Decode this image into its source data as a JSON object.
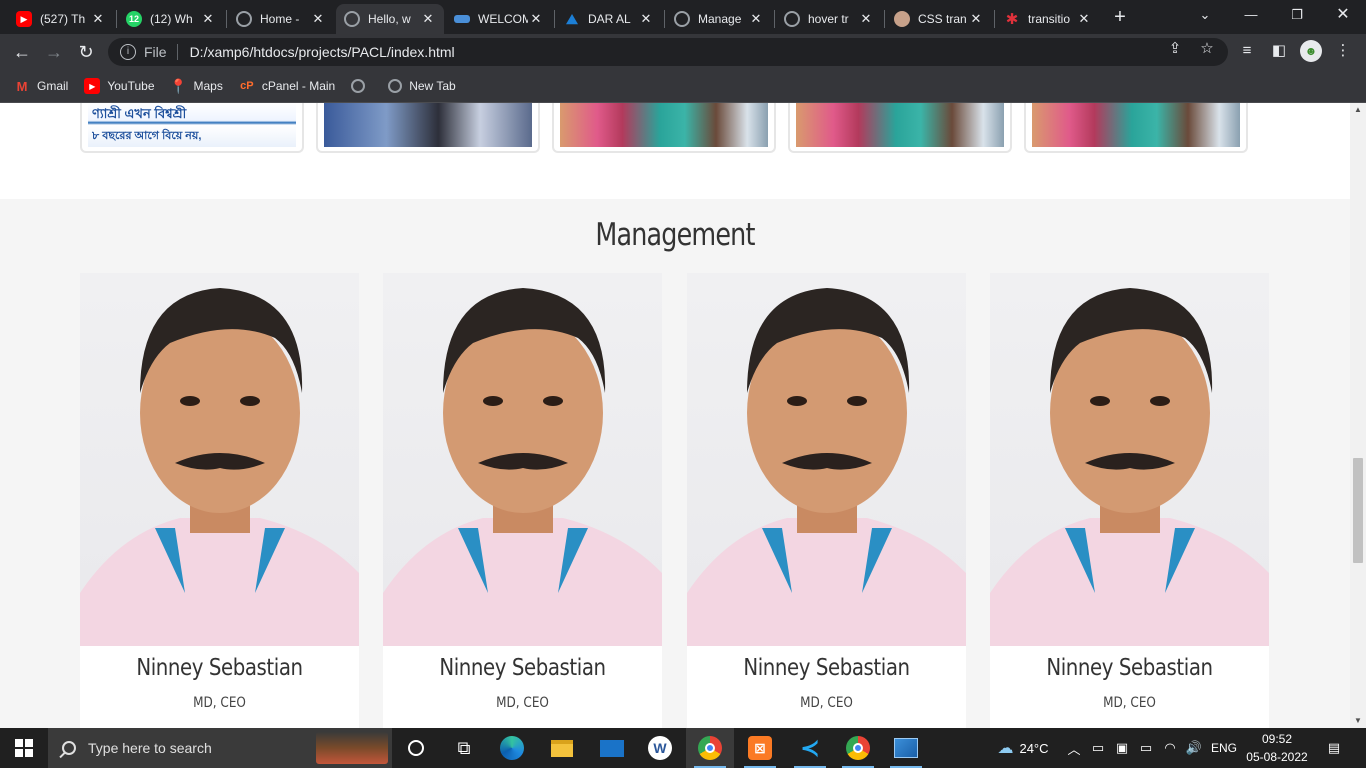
{
  "browser": {
    "tabs": [
      {
        "title": "(527) Th",
        "icon": "youtube-icon",
        "color": "#ff0000",
        "glyph": "▶"
      },
      {
        "title": "(12) Wh",
        "icon": "whatsapp-icon",
        "color": "#25d366",
        "glyph": "12"
      },
      {
        "title": "Home -",
        "icon": "globe-icon",
        "color": "#9aa0a6",
        "glyph": ""
      },
      {
        "title": "Hello, w",
        "icon": "globe-icon",
        "color": "#9aa0a6",
        "glyph": ""
      },
      {
        "title": "WELCOM",
        "icon": "site-icon",
        "color": "#4a8fd8",
        "glyph": ""
      },
      {
        "title": "DAR AL",
        "icon": "site-icon",
        "color": "#1c7fd6",
        "glyph": ""
      },
      {
        "title": "Manage",
        "icon": "globe-icon",
        "color": "#9aa0a6",
        "glyph": ""
      },
      {
        "title": "hover tr",
        "icon": "globe-icon",
        "color": "#9aa0a6",
        "glyph": ""
      },
      {
        "title": "CSS tran",
        "icon": "github-icon",
        "color": "#c7a18a",
        "glyph": ""
      },
      {
        "title": "transitio",
        "icon": "asterisk-icon",
        "color": "#e0313b",
        "glyph": "✱"
      }
    ],
    "address": {
      "scheme_label": "File",
      "url": "D:/xamp6/htdocs/projects/PACL/index.html"
    },
    "bookmarks": [
      {
        "label": "Gmail",
        "icon": "gmail-icon",
        "color": "#ea4335",
        "glyph": "M"
      },
      {
        "label": "YouTube",
        "icon": "youtube-icon",
        "color": "#ff0000",
        "glyph": "▶"
      },
      {
        "label": "Maps",
        "icon": "maps-icon",
        "color": "#34a853",
        "glyph": "⬤"
      },
      {
        "label": "cPanel - Main",
        "icon": "cpanel-icon",
        "color": "#ff6c2c",
        "glyph": "cP"
      },
      {
        "label": "",
        "icon": "globe-icon",
        "color": "#9aa0a6",
        "glyph": ""
      },
      {
        "label": "New Tab",
        "icon": "globe-icon",
        "color": "#9aa0a6",
        "glyph": ""
      }
    ]
  },
  "page": {
    "section_title": "Management",
    "team": [
      {
        "name": "Ninney Sebastian",
        "role": "MD, CEO"
      },
      {
        "name": "Ninney Sebastian",
        "role": "MD, CEO"
      },
      {
        "name": "Ninney Sebastian",
        "role": "MD, CEO"
      },
      {
        "name": "Ninney Sebastian",
        "role": "MD, CEO"
      }
    ],
    "gallery_banner_text": "ণ্যাশ্রী এখন বিশ্বশ্রী",
    "gallery_banner_text2": "৮ বছরের আগে বিয়ে নয়,"
  },
  "taskbar": {
    "search_placeholder": "Type here to search",
    "weather": "24°C",
    "language": "ENG",
    "time": "09:52",
    "date": "05-08-2022"
  }
}
